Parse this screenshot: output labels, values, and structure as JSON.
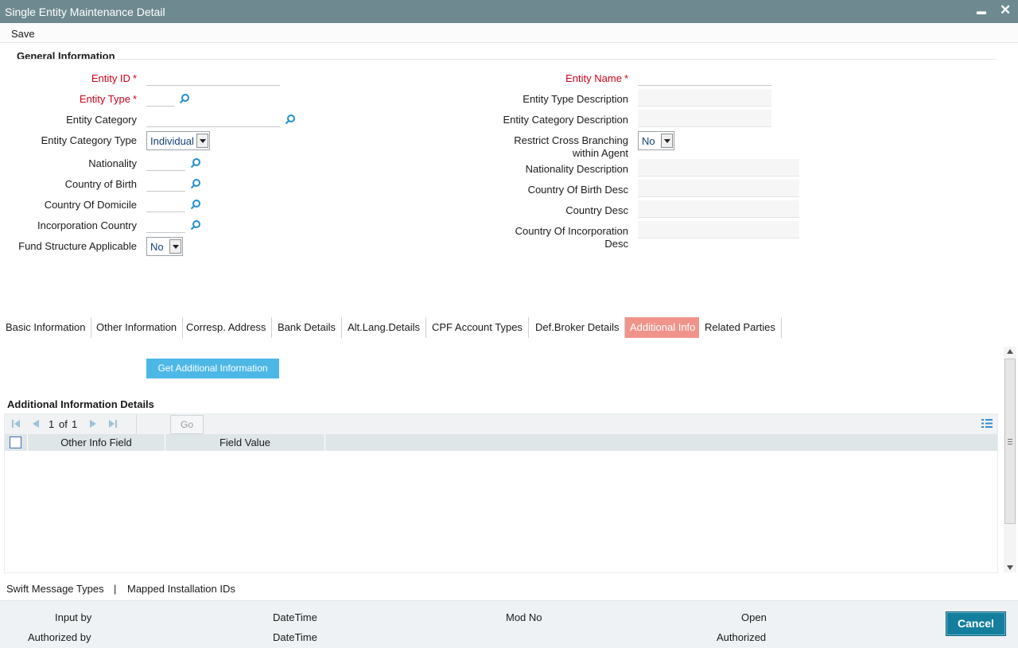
{
  "window": {
    "title": "Single Entity Maintenance Detail",
    "minimize": "▬",
    "close": "✕"
  },
  "toolbar": {
    "save_label": "Save"
  },
  "general": {
    "title": "General Information",
    "entity_id_label": "Entity ID",
    "entity_type_label": "Entity Type",
    "entity_category_label": "Entity Category",
    "entity_category_type_label": "Entity Category Type",
    "entity_category_type_value": "Individual",
    "nationality_label": "Nationality",
    "country_of_birth_label": "Country of Birth",
    "country_of_domicile_label": "Country Of Domicile",
    "incorporation_country_label": "Incorporation Country",
    "fund_structure_label": "Fund Structure Applicable",
    "fund_structure_value": "No",
    "entity_name_label": "Entity Name",
    "entity_type_desc_label": "Entity Type Description",
    "entity_category_desc_label": "Entity Category Description",
    "restrict_cross_label_1": "Restrict Cross Branching",
    "restrict_cross_label_2": "within Agent",
    "restrict_cross_value": "No",
    "nationality_desc_label": "Nationality Description",
    "country_birth_desc_label": "Country Of Birth Desc",
    "country_desc_label": "Country Desc",
    "country_incorp_desc_label_1": "Country Of Incorporation",
    "country_incorp_desc_label_2": "Desc",
    "required_marker": "*"
  },
  "tabs": [
    {
      "label": "Basic Information"
    },
    {
      "label": "Other Information"
    },
    {
      "label": "Corresp. Address"
    },
    {
      "label": "Bank Details"
    },
    {
      "label": "Alt.Lang.Details"
    },
    {
      "label": "CPF Account Types"
    },
    {
      "label": "Def.Broker Details"
    },
    {
      "label": "Additional Info",
      "active": true
    },
    {
      "label": "Related Parties"
    }
  ],
  "additional": {
    "get_button": "Get Additional Information",
    "details_title": "Additional Information Details",
    "pager": {
      "current": "1",
      "of_label": "of",
      "total": "1",
      "go_label": "Go"
    },
    "columns": [
      "Other Info Field",
      "Field Value"
    ]
  },
  "footer_links": {
    "swift": "Swift Message Types",
    "separator": "|",
    "mapped": "Mapped Installation IDs"
  },
  "footer": {
    "input_by": "Input by",
    "authorized_by": "Authorized by",
    "datetime_1": "DateTime",
    "datetime_2": "DateTime",
    "mod_no": "Mod No",
    "open": "Open",
    "authorized": "Authorized",
    "cancel": "Cancel"
  },
  "colors": {
    "titlebar": "#6e8a90",
    "active_tab": "#f0938a",
    "button_blue": "#4db8e6",
    "cancel": "#137e9e",
    "required": "#d0021b"
  }
}
